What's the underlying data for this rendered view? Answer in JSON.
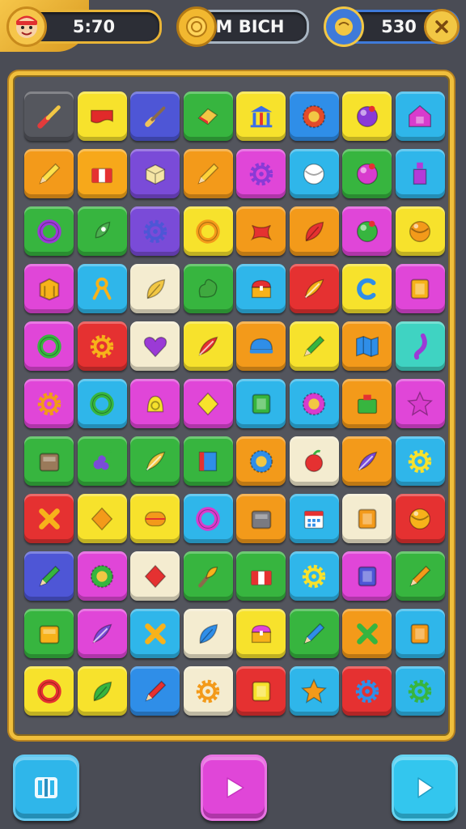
{
  "hud": {
    "player_score": "5:70",
    "middle_label": "M BICH",
    "right_score": "530"
  },
  "colors": {
    "board_border": "#f0bf3c",
    "background": "#4a4c55",
    "menu_button": "#2fb6ea",
    "play_button": "#e046d8",
    "next_button": "#33c6ee"
  },
  "board": {
    "rows": [
      [
        {
          "bg": "#55575e",
          "icon": "screwdriver-icon",
          "c": "#e23b3b"
        },
        {
          "bg": "#f7e22c",
          "icon": "banner-icon",
          "c": "#e12a2a"
        },
        {
          "bg": "#4e56d6",
          "icon": "brush-icon",
          "c": "#f0c35a"
        },
        {
          "bg": "#37b53f",
          "icon": "eraser-icon",
          "c": "#f2c744"
        },
        {
          "bg": "#f7e22c",
          "icon": "temple-icon",
          "c": "#3a6ee8"
        },
        {
          "bg": "#2f8ee8",
          "icon": "ring-gear-icon",
          "c": "#e24b2a"
        },
        {
          "bg": "#f7e22c",
          "icon": "orb-icon",
          "c": "#8a3ad6"
        },
        {
          "bg": "#2fb6ea",
          "icon": "house-icon",
          "c": "#d83ccd"
        }
      ],
      [
        {
          "bg": "#f39a1a",
          "icon": "pencil-icon",
          "c": "#ffe14a"
        },
        {
          "bg": "#f7a81a",
          "icon": "flag-box-icon",
          "c": "#e53131"
        },
        {
          "bg": "#7a4bd8",
          "icon": "cube-icon",
          "c": "#f5e5a5"
        },
        {
          "bg": "#f39a1a",
          "icon": "pencil-icon",
          "c": "#ffd23a"
        },
        {
          "bg": "#e046d8",
          "icon": "gear-icon",
          "c": "#8a3ad6"
        },
        {
          "bg": "#2fb6ea",
          "icon": "ball-icon",
          "c": "#ffffff"
        },
        {
          "bg": "#37b53f",
          "icon": "orb-icon",
          "c": "#d83ccd"
        },
        {
          "bg": "#2fb6ea",
          "icon": "bottle-icon",
          "c": "#b33ad8"
        }
      ],
      [
        {
          "bg": "#37b53f",
          "icon": "ring-icon",
          "c": "#9b3ad6"
        },
        {
          "bg": "#37b53f",
          "icon": "rocket-icon",
          "c": "#4caf50"
        },
        {
          "bg": "#7a4bd8",
          "icon": "gear-icon",
          "c": "#4e56d6"
        },
        {
          "bg": "#f7e22c",
          "icon": "ring-icon",
          "c": "#f39a1a"
        },
        {
          "bg": "#f39a1a",
          "icon": "x-shape-icon",
          "c": "#e53131"
        },
        {
          "bg": "#f39a1a",
          "icon": "leaf-icon",
          "c": "#e53131"
        },
        {
          "bg": "#e046d8",
          "icon": "orb-icon",
          "c": "#37b53f"
        },
        {
          "bg": "#f7e22c",
          "icon": "ball-icon",
          "c": "#f39a1a"
        }
      ],
      [
        {
          "bg": "#e046d8",
          "icon": "crate-icon",
          "c": "#f7b21a"
        },
        {
          "bg": "#2fb6ea",
          "icon": "ribbon-icon",
          "c": "#f7b21a"
        },
        {
          "bg": "#f4ecd0",
          "icon": "leaf-icon",
          "c": "#f2c744"
        },
        {
          "bg": "#37b53f",
          "icon": "blob-icon",
          "c": "#3fa93f"
        },
        {
          "bg": "#2fb6ea",
          "icon": "chest-icon",
          "c": "#e53131"
        },
        {
          "bg": "#e53131",
          "icon": "feather-icon",
          "c": "#f7b21a"
        },
        {
          "bg": "#f7e22c",
          "icon": "c-ring-icon",
          "c": "#2f8ee8"
        },
        {
          "bg": "#e046d8",
          "icon": "frame-icon",
          "c": "#f7b21a"
        }
      ],
      [
        {
          "bg": "#e046d8",
          "icon": "ring-icon",
          "c": "#37b53f"
        },
        {
          "bg": "#e53131",
          "icon": "gear-icon",
          "c": "#f7b21a"
        },
        {
          "bg": "#f4ecd0",
          "icon": "heart-icon",
          "c": "#9b3ad6"
        },
        {
          "bg": "#f7e22c",
          "icon": "feather-icon",
          "c": "#e53131"
        },
        {
          "bg": "#f39a1a",
          "icon": "cap-icon",
          "c": "#2f8ee8"
        },
        {
          "bg": "#f7e22c",
          "icon": "pencil-icon",
          "c": "#37b53f"
        },
        {
          "bg": "#f39a1a",
          "icon": "map-icon",
          "c": "#2f8ee8"
        },
        {
          "bg": "#3fd3c2",
          "icon": "hook-icon",
          "c": "#9b3ad6"
        }
      ],
      [
        {
          "bg": "#e046d8",
          "icon": "gear-icon",
          "c": "#f39a1a"
        },
        {
          "bg": "#2fb6ea",
          "icon": "ring-icon",
          "c": "#37b53f"
        },
        {
          "bg": "#e046d8",
          "icon": "bell-icon",
          "c": "#f7e22c"
        },
        {
          "bg": "#e046d8",
          "icon": "diamond-icon",
          "c": "#f7e22c"
        },
        {
          "bg": "#2fb6ea",
          "icon": "frame-icon",
          "c": "#37b53f"
        },
        {
          "bg": "#2fb6ea",
          "icon": "ring-gear-icon",
          "c": "#d83ccd"
        },
        {
          "bg": "#f39a1a",
          "icon": "bag-icon",
          "c": "#37b53f"
        },
        {
          "bg": "#e046d8",
          "icon": "star-icon",
          "c": "#d83ccd"
        }
      ],
      [
        {
          "bg": "#37b53f",
          "icon": "box-icon",
          "c": "#9a7a5a"
        },
        {
          "bg": "#37b53f",
          "icon": "grapes-icon",
          "c": "#7a4bd8"
        },
        {
          "bg": "#37b53f",
          "icon": "feather-icon",
          "c": "#f2c744"
        },
        {
          "bg": "#37b53f",
          "icon": "book-icon",
          "c": "#2f8ee8"
        },
        {
          "bg": "#f39a1a",
          "icon": "ring-gear-icon",
          "c": "#2f8ee8"
        },
        {
          "bg": "#f4ecd0",
          "icon": "apple-icon",
          "c": "#e53131"
        },
        {
          "bg": "#f39a1a",
          "icon": "feather-icon",
          "c": "#7a4bd8"
        },
        {
          "bg": "#2fb6ea",
          "icon": "gear-icon",
          "c": "#f7e22c"
        }
      ],
      [
        {
          "bg": "#e53131",
          "icon": "cross-icon",
          "c": "#f7b21a"
        },
        {
          "bg": "#f7e22c",
          "icon": "diamond-icon",
          "c": "#f39a1a"
        },
        {
          "bg": "#f7e22c",
          "icon": "capsule-icon",
          "c": "#f39a1a"
        },
        {
          "bg": "#2fb6ea",
          "icon": "ring-icon",
          "c": "#d83ccd"
        },
        {
          "bg": "#f39a1a",
          "icon": "box-icon",
          "c": "#7a7a80"
        },
        {
          "bg": "#2fb6ea",
          "icon": "calendar-icon",
          "c": "#e53131"
        },
        {
          "bg": "#f4ecd0",
          "icon": "frame-icon",
          "c": "#f39a1a"
        },
        {
          "bg": "#e53131",
          "icon": "ball-icon",
          "c": "#f7b21a"
        }
      ],
      [
        {
          "bg": "#4e56d6",
          "icon": "pencil-icon",
          "c": "#37b53f"
        },
        {
          "bg": "#e046d8",
          "icon": "ring-gear-icon",
          "c": "#37b53f"
        },
        {
          "bg": "#f4ecd0",
          "icon": "diamond-icon",
          "c": "#e53131"
        },
        {
          "bg": "#37b53f",
          "icon": "torch-icon",
          "c": "#f7b21a"
        },
        {
          "bg": "#37b53f",
          "icon": "flag-box-icon",
          "c": "#e53131"
        },
        {
          "bg": "#2fb6ea",
          "icon": "gear-icon",
          "c": "#f7e22c"
        },
        {
          "bg": "#e046d8",
          "icon": "frame-icon",
          "c": "#4e56d6"
        },
        {
          "bg": "#37b53f",
          "icon": "pencil-icon",
          "c": "#f39a1a"
        }
      ],
      [
        {
          "bg": "#37b53f",
          "icon": "box-icon",
          "c": "#f7b21a"
        },
        {
          "bg": "#e046d8",
          "icon": "feather-icon",
          "c": "#7a4bd8"
        },
        {
          "bg": "#2fb6ea",
          "icon": "cross-icon",
          "c": "#f7b21a"
        },
        {
          "bg": "#f4ecd0",
          "icon": "leaf-icon",
          "c": "#2f8ee8"
        },
        {
          "bg": "#f7e22c",
          "icon": "chest-icon",
          "c": "#e046d8"
        },
        {
          "bg": "#37b53f",
          "icon": "pencil-icon",
          "c": "#2f8ee8"
        },
        {
          "bg": "#f39a1a",
          "icon": "cross-icon",
          "c": "#37b53f"
        },
        {
          "bg": "#2fb6ea",
          "icon": "frame-icon",
          "c": "#f39a1a"
        }
      ],
      [
        {
          "bg": "#f7e22c",
          "icon": "ring-icon",
          "c": "#e53131"
        },
        {
          "bg": "#f7e22c",
          "icon": "leaf-icon",
          "c": "#37b53f"
        },
        {
          "bg": "#2f8ee8",
          "icon": "pencil-icon",
          "c": "#e53131"
        },
        {
          "bg": "#f4ecd0",
          "icon": "gear-icon",
          "c": "#f39a1a"
        },
        {
          "bg": "#e53131",
          "icon": "frame-icon",
          "c": "#f7e22c"
        },
        {
          "bg": "#2fb6ea",
          "icon": "star-icon",
          "c": "#f39a1a"
        },
        {
          "bg": "#e53131",
          "icon": "gear-icon",
          "c": "#2f8ee8"
        },
        {
          "bg": "#2fb6ea",
          "icon": "gear-icon",
          "c": "#37b53f"
        }
      ]
    ]
  },
  "buttons": {
    "menu": "book-icon",
    "play": "play-icon",
    "next": "next-icon"
  }
}
